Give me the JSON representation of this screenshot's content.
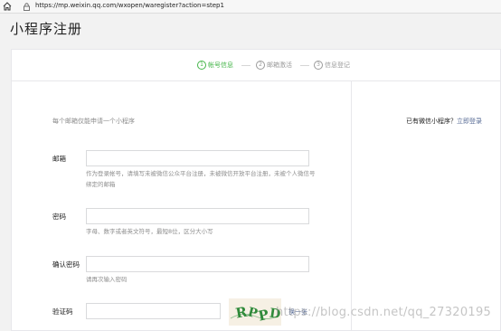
{
  "browser": {
    "url": "https://mp.weixin.qq.com/wxopen/waregister?action=step1"
  },
  "page": {
    "title": "小程序注册"
  },
  "steps": [
    {
      "num": "1",
      "label": "帐号信息",
      "active": true
    },
    {
      "num": "2",
      "label": "邮箱激活",
      "active": false
    },
    {
      "num": "3",
      "label": "信息登记",
      "active": false
    }
  ],
  "form": {
    "tip": "每个邮箱仅能申请一个小程序",
    "email": {
      "label": "邮箱",
      "value": "",
      "hint": "作为登录帐号，请填写未被微信公众平台注册，未被微信开放平台注册，未被个人微信号绑定的邮箱"
    },
    "password": {
      "label": "密码",
      "value": "",
      "hint": "字母、数字或者英文符号，最短8位，区分大小写"
    },
    "confirm_password": {
      "label": "确认密码",
      "value": "",
      "hint": "请再次输入密码"
    },
    "captcha": {
      "label": "验证码",
      "value": "",
      "image_text": "RPPD",
      "refresh_label": "换一张"
    }
  },
  "sidebar": {
    "already_text": "已有微信小程序？",
    "login_link": "立即登录"
  },
  "watermark": "https://blog.csdn.net/qq_27320195",
  "colors": {
    "accent_green": "#44b549",
    "link_blue": "#576b95",
    "hint_gray": "#8d8d8d"
  }
}
